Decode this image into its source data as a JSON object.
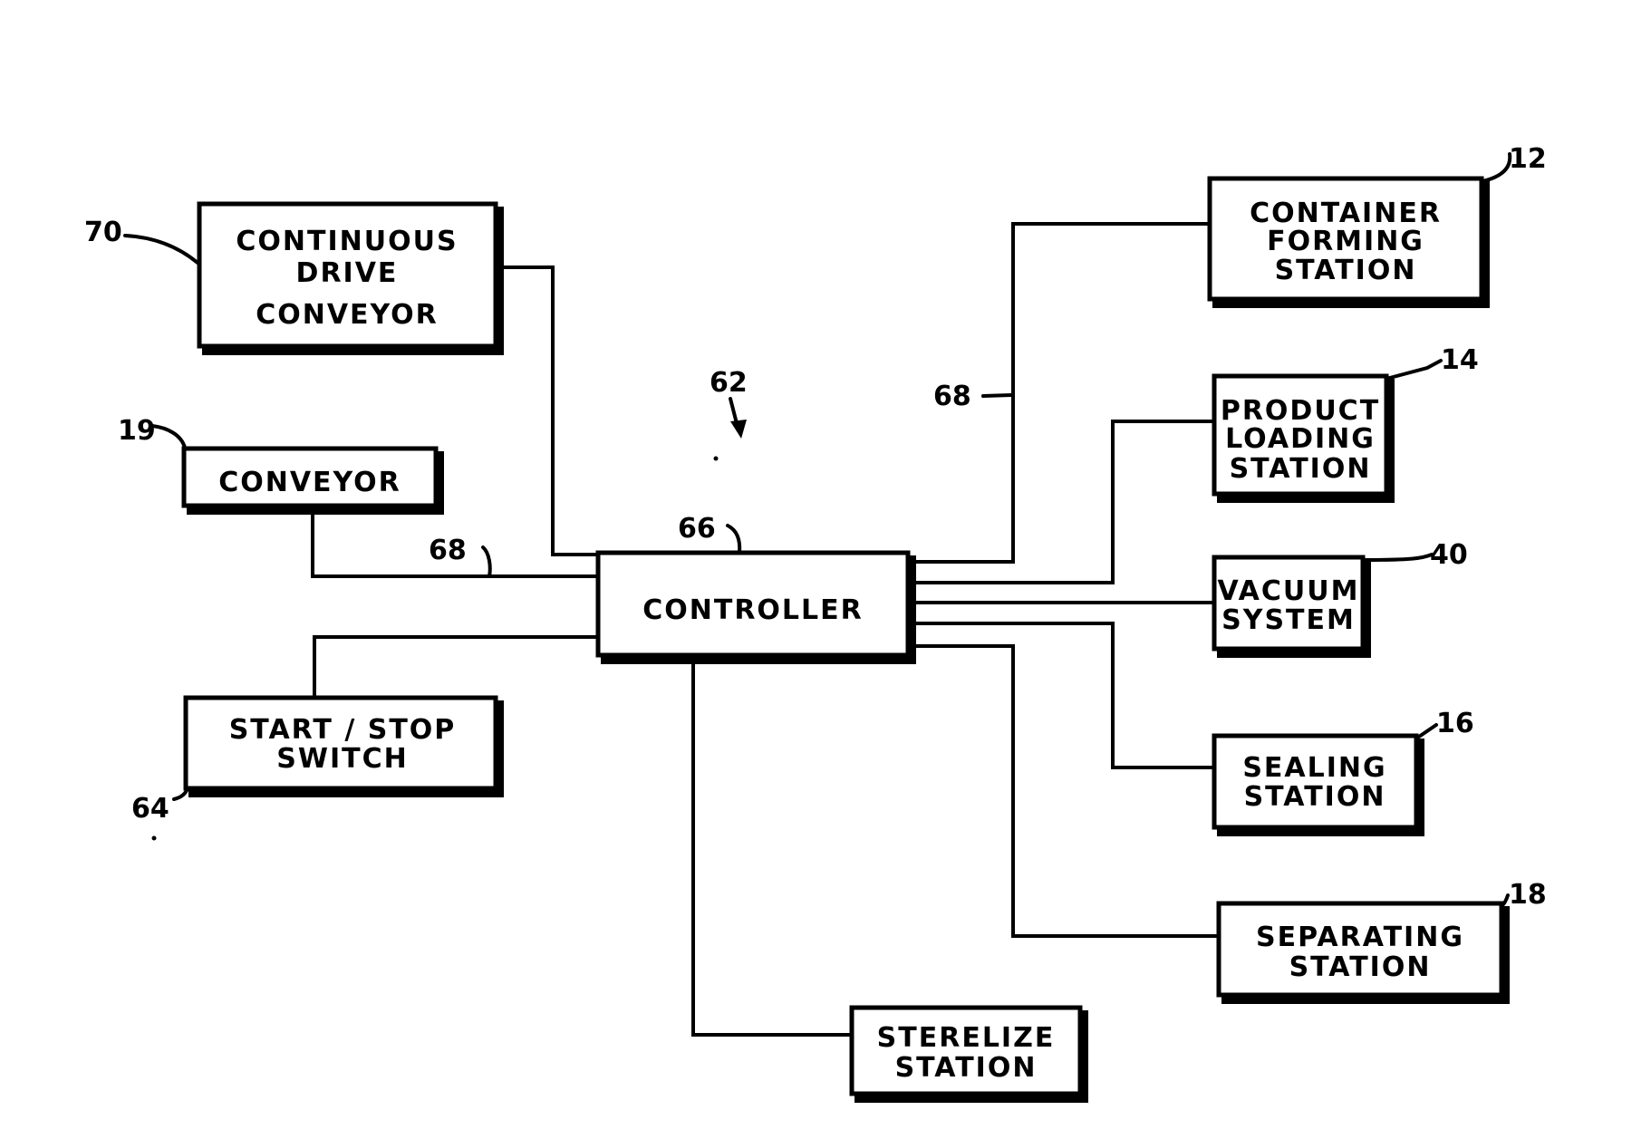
{
  "figure": {
    "reference": "62",
    "controller": {
      "label": "CONTROLLER",
      "ref": "66"
    },
    "bus_ref": "68",
    "blocks": [
      {
        "id": "continuous-drive-conveyor",
        "lines": [
          "CONTINUOUS",
          "DRIVE",
          "CONVEYOR"
        ],
        "ref": "70"
      },
      {
        "id": "conveyor",
        "lines": [
          "CONVEYOR"
        ],
        "ref": "19"
      },
      {
        "id": "start-stop-switch",
        "lines": [
          "START / STOP",
          "SWITCH"
        ],
        "ref": "64"
      },
      {
        "id": "container-forming-station",
        "lines": [
          "CONTAINER",
          "FORMING",
          "STATION"
        ],
        "ref": "12"
      },
      {
        "id": "product-loading-station",
        "lines": [
          "PRODUCT",
          "LOADING",
          "STATION"
        ],
        "ref": "14"
      },
      {
        "id": "vacuum-system",
        "lines": [
          "VACUUM",
          "SYSTEM"
        ],
        "ref": "40"
      },
      {
        "id": "sealing-station",
        "lines": [
          "SEALING",
          "STATION"
        ],
        "ref": "16"
      },
      {
        "id": "separating-station",
        "lines": [
          "SEPARATING",
          "STATION"
        ],
        "ref": "18"
      },
      {
        "id": "sterelize-station",
        "lines": [
          "STERELIZE",
          "STATION"
        ],
        "ref": ""
      }
    ],
    "connections": [
      [
        "controller",
        "continuous-drive-conveyor"
      ],
      [
        "controller",
        "conveyor"
      ],
      [
        "controller",
        "start-stop-switch"
      ],
      [
        "controller",
        "container-forming-station"
      ],
      [
        "controller",
        "product-loading-station"
      ],
      [
        "controller",
        "vacuum-system"
      ],
      [
        "controller",
        "sealing-station"
      ],
      [
        "controller",
        "separating-station"
      ],
      [
        "controller",
        "sterelize-station"
      ]
    ]
  }
}
